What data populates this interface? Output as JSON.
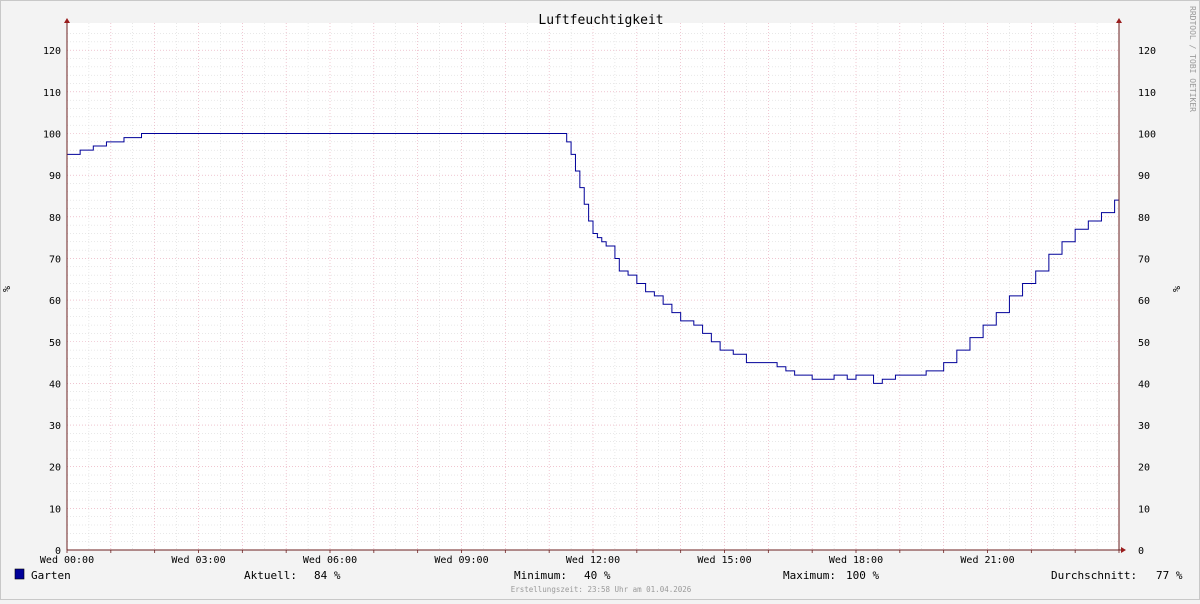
{
  "chart_data": {
    "type": "line",
    "title": "Luftfeuchtigkeit",
    "ylabel": "%",
    "ylabel_right": "%",
    "ylim": [
      0,
      125
    ],
    "yticks": [
      0,
      10,
      20,
      30,
      40,
      50,
      60,
      70,
      80,
      90,
      100,
      110,
      120
    ],
    "xticks": [
      "Wed 00:00",
      "Wed 03:00",
      "Wed 06:00",
      "Wed 09:00",
      "Wed 12:00",
      "Wed 15:00",
      "Wed 18:00",
      "Wed 21:00"
    ],
    "xtick_hours": [
      0,
      3,
      6,
      9,
      12,
      15,
      18,
      21
    ],
    "xlim_hours": [
      0,
      24
    ],
    "grid": true,
    "colors": {
      "series": "#000099",
      "grid_major": "#e6a3b4",
      "grid_minor": "#d2d2d2",
      "axis": "#6b1f1f",
      "canvas": "#ffffff",
      "background": "#f3f3f3"
    },
    "series": [
      {
        "name": "Garten",
        "color": "#000099",
        "x_hours": [
          0,
          0.1,
          0.3,
          0.5,
          0.6,
          0.7,
          0.9,
          1.0,
          1.3,
          1.4,
          1.7,
          1.8,
          2.0,
          3.0,
          6.0,
          9.0,
          11.0,
          11.3,
          11.4,
          11.5,
          11.6,
          11.7,
          11.8,
          11.9,
          12.0,
          12.1,
          12.2,
          12.3,
          12.5,
          12.6,
          12.8,
          13.0,
          13.2,
          13.4,
          13.6,
          13.8,
          14.0,
          14.2,
          14.3,
          14.5,
          14.7,
          14.9,
          15.2,
          15.5,
          15.8,
          16.0,
          16.2,
          16.4,
          16.6,
          16.8,
          17.0,
          17.2,
          17.5,
          17.8,
          18.0,
          18.2,
          18.4,
          18.6,
          18.9,
          19.3,
          19.6,
          19.8,
          20.0,
          20.3,
          20.6,
          20.9,
          21.2,
          21.5,
          21.8,
          22.1,
          22.4,
          22.7,
          23.0,
          23.3,
          23.6,
          23.9
        ],
        "values": [
          95,
          95,
          96,
          96,
          97,
          97,
          98,
          98,
          99,
          99,
          100,
          100,
          100,
          100,
          100,
          100,
          100,
          100,
          98,
          95,
          91,
          87,
          83,
          79,
          76,
          75,
          74,
          73,
          70,
          67,
          66,
          64,
          62,
          61,
          59,
          57,
          55,
          55,
          54,
          52,
          50,
          48,
          47,
          45,
          45,
          45,
          44,
          43,
          42,
          42,
          41,
          41,
          42,
          41,
          42,
          42,
          40,
          41,
          42,
          42,
          43,
          43,
          45,
          48,
          51,
          54,
          57,
          61,
          64,
          67,
          71,
          74,
          77,
          79,
          81,
          84
        ]
      }
    ],
    "legend": {
      "label": "Garten",
      "aktuell_label": "Aktuell:",
      "aktuell_value": "84 %",
      "minimum_label": "Minimum:",
      "minimum_value": "40 %",
      "maximum_label": "Maximum:",
      "maximum_value": "100 %",
      "avg_label": "Durchschnitt:",
      "avg_value": "77 %"
    },
    "footer": "Erstellungszeit: 23:58 Uhr am 01.04.2026",
    "watermark": "RRDTOOL / TOBI OETIKER"
  }
}
